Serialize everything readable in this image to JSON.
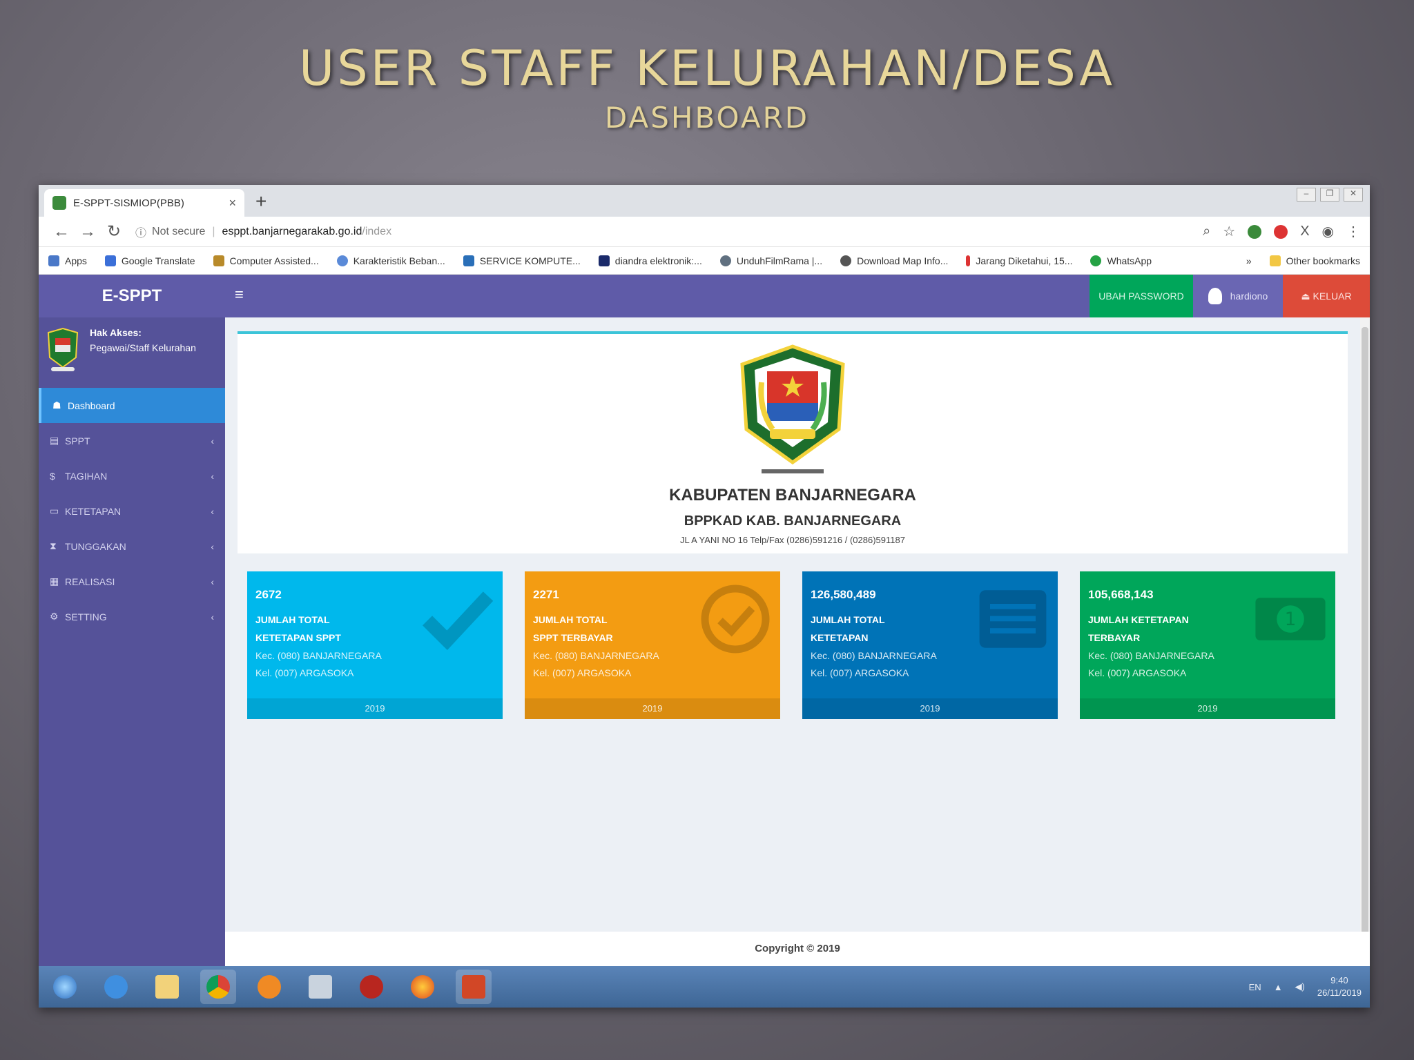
{
  "slide": {
    "title": "USER STAFF KELURAHAN/DESA",
    "subtitle": "DASHBOARD"
  },
  "browser": {
    "tab_title": "E-SPPT-SISMIOP(PBB)",
    "tab_close": "×",
    "new_tab": "+",
    "security": "Not secure",
    "url_host": "esppt.banjarnegarakab.go.id",
    "url_path": "/index",
    "bookmarks": [
      {
        "label": "Apps",
        "icon": "apps-grid-icon"
      },
      {
        "label": "Google Translate",
        "icon": "translate-icon"
      },
      {
        "label": "Computer Assisted...",
        "icon": "bookmark-icon"
      },
      {
        "label": "Karakteristik Beban...",
        "icon": "bookmark-icon"
      },
      {
        "label": "SERVICE KOMPUTE...",
        "icon": "bookmark-icon"
      },
      {
        "label": "diandra elektronik:...",
        "icon": "bookmark-icon"
      },
      {
        "label": "UnduhFilmRama |...",
        "icon": "bookmark-icon"
      },
      {
        "label": "Download Map Info...",
        "icon": "bookmark-icon"
      },
      {
        "label": "Jarang Diketahui, 15...",
        "icon": "bookmark-icon"
      },
      {
        "label": "WhatsApp",
        "icon": "whatsapp-icon"
      }
    ],
    "bookmarks_more": "»",
    "other_bookmarks": "Other bookmarks"
  },
  "app": {
    "brand": "E-SPPT",
    "access_label": "Hak Akses:",
    "access_role": "Pegawai/Staff Kelurahan",
    "menu": [
      {
        "label": "Dashboard",
        "icon": "dashboard-icon",
        "glyph": "☗",
        "active": true
      },
      {
        "label": "SPPT",
        "icon": "database-icon",
        "glyph": "▤",
        "active": false
      },
      {
        "label": "TAGIHAN",
        "icon": "money-icon",
        "glyph": "$",
        "active": false
      },
      {
        "label": "KETETAPAN",
        "icon": "monitor-icon",
        "glyph": "▭",
        "active": false
      },
      {
        "label": "TUNGGAKAN",
        "icon": "hourglass-icon",
        "glyph": "⧗",
        "active": false
      },
      {
        "label": "REALISASI",
        "icon": "report-icon",
        "glyph": "▦",
        "active": false
      },
      {
        "label": "SETTING",
        "icon": "cogs-icon",
        "glyph": "⚙",
        "active": false
      }
    ],
    "menu_chevron": "‹",
    "hamburger": "≡",
    "change_password": "UBAH PASSWORD",
    "username": "hardiono",
    "logout": "KELUAR",
    "org_title": "KABUPATEN BANJARNEGARA",
    "org_subtitle": "BPPKAD KAB. BANJARNEGARA",
    "org_address": "JL A YANI NO 16 Telp/Fax (0286)591216 / (0286)591187",
    "cards": [
      {
        "value": "2672",
        "line1": "JUMLAH TOTAL",
        "line2": "KETETAPAN SPPT",
        "kec": "Kec. (080) BANJARNEGARA",
        "kel": "Kel. (007) ARGASOKA",
        "year": "2019",
        "color": "#00b8ec",
        "icon": "check-icon"
      },
      {
        "value": "2271",
        "line1": "JUMLAH TOTAL",
        "line2": "SPPT TERBAYAR",
        "kec": "Kec. (080) BANJARNEGARA",
        "kel": "Kel. (007) ARGASOKA",
        "year": "2019",
        "color": "#f39c12",
        "icon": "check-circle-icon"
      },
      {
        "value": "126,580,489",
        "line1": "JUMLAH TOTAL",
        "line2": "KETETAPAN",
        "kec": "Kec. (080) BANJARNEGARA",
        "kel": "Kel. (007) ARGASOKA",
        "year": "2019",
        "color": "#0073b7",
        "icon": "list-icon"
      },
      {
        "value": "105,668,143",
        "line1": "JUMLAH KETETAPAN",
        "line2": "TERBAYAR",
        "kec": "Kec. (080) BANJARNEGARA",
        "kel": "Kel. (007) ARGASOKA",
        "year": "2019",
        "color": "#00a65a",
        "icon": "money-bill-icon"
      }
    ],
    "copyright": "Copyright © 2019"
  },
  "taskbar": {
    "language": "EN",
    "time": "9:40",
    "date": "26/11/2019",
    "apps": [
      "windows-start-icon",
      "internet-explorer-icon",
      "file-explorer-icon",
      "chrome-icon",
      "media-player-icon",
      "paint-icon",
      "app-red-icon",
      "firefox-icon",
      "powerpoint-icon"
    ]
  }
}
